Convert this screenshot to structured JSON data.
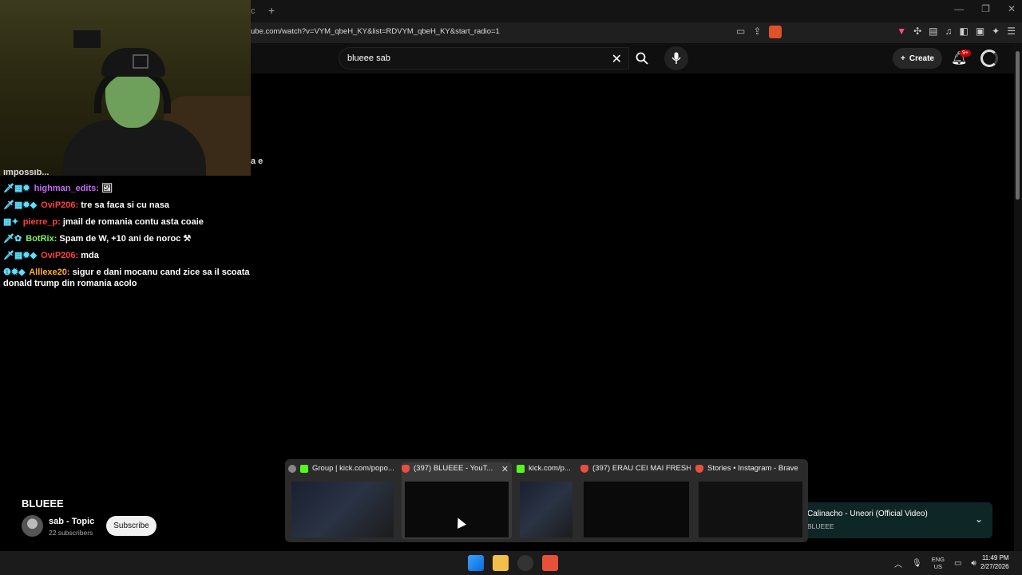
{
  "browser": {
    "new_tab_label": "+",
    "url": "ube.com/watch?v=VYM_qbeH_KY&list=RDVYM_qbeH_KY&start_radio=1"
  },
  "youtube": {
    "search_value": "blueee sab",
    "create_label": "Create",
    "notification_count": "9+",
    "video_title": "BLUEEE",
    "channel_name": "sab - Topic",
    "subscriber_count": "22 subscribers",
    "subscribe_label": "Subscribe",
    "mini_player": {
      "title": "Calinacho - Uneori (Official Video)",
      "artist": "BLUEEE"
    }
  },
  "chat": {
    "cut_line": "impossib...",
    "overlap_text": "a e",
    "messages": [
      {
        "user": "highman_edits:",
        "text": "",
        "color": "#c46cf6"
      },
      {
        "user": "OviP206:",
        "text": "tre sa faca si cu nasa",
        "color": "#ff4040"
      },
      {
        "user": "pierre_p:",
        "text": "jmail de romania contu asta coaie",
        "color": "#ff4040"
      },
      {
        "user": "BotRix:",
        "text": "Spam de W, +10 ani de noroc",
        "color": "#7cf55a"
      },
      {
        "user": "OviP206:",
        "text": "mda",
        "color": "#ff4040"
      },
      {
        "user": "Alllexe20:",
        "text": "sigur e dani mocanu cand zice sa il scoata donald trump din romania acolo",
        "color": "#ffb02e"
      }
    ]
  },
  "thumbnails": [
    {
      "title": "Group | kick.com/popo...",
      "favicon": "obs"
    },
    {
      "title": "(397) BLUEEE - YouT...",
      "favicon": "brave"
    },
    {
      "title": "kick.com/p...",
      "favicon": "kick"
    },
    {
      "title": "(397) ERAU CEI MAI FRESH...",
      "favicon": "brave"
    },
    {
      "title": "Stories • Instagram - Brave",
      "favicon": "brave"
    }
  ],
  "taskbar": {
    "lang_top": "ENG",
    "lang_bottom": "US",
    "time": "11:49 PM",
    "date": "2/27/2026"
  }
}
